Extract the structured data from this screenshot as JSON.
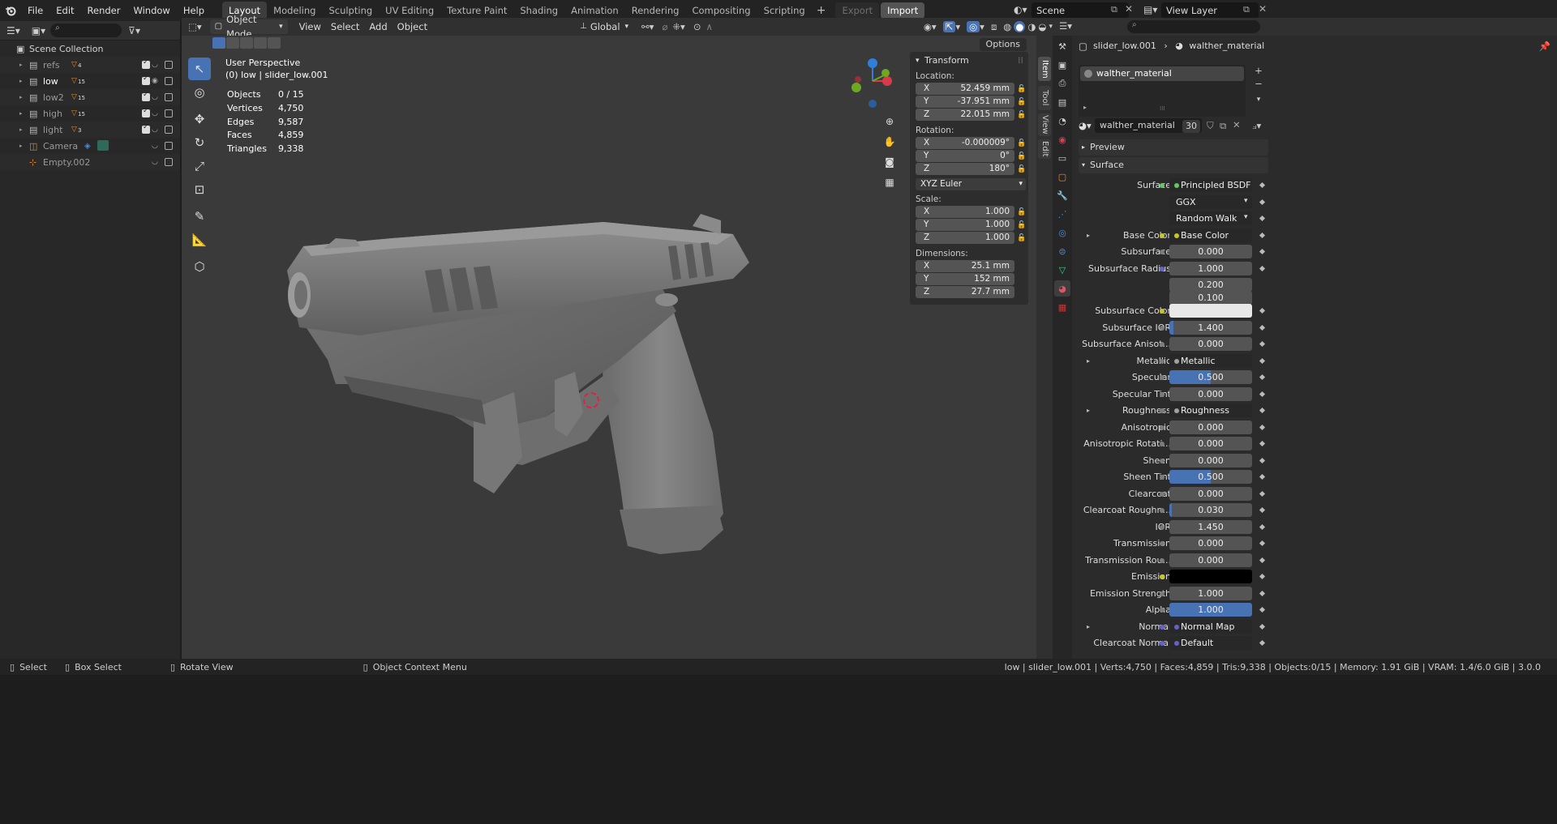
{
  "menu": [
    "File",
    "Edit",
    "Render",
    "Window",
    "Help"
  ],
  "workspaces": [
    "Layout",
    "Modeling",
    "Sculpting",
    "UV Editing",
    "Texture Paint",
    "Shading",
    "Animation",
    "Rendering",
    "Compositing",
    "Scripting"
  ],
  "export_label": "Export",
  "import_label": "Import",
  "scene_name": "Scene",
  "view_layer": "View Layer",
  "outliner": {
    "root": "Scene Collection",
    "items": [
      {
        "name": "refs",
        "count": "4"
      },
      {
        "name": "low",
        "count": "15"
      },
      {
        "name": "low2",
        "count": "15"
      },
      {
        "name": "high",
        "count": "15"
      },
      {
        "name": "light",
        "count": "3"
      },
      {
        "name": "Camera",
        "count": ""
      },
      {
        "name": "Empty.002",
        "count": ""
      }
    ]
  },
  "viewport": {
    "mode": "Object Mode",
    "menus": [
      "View",
      "Select",
      "Add",
      "Object"
    ],
    "orientation": "Global",
    "options": "Options",
    "perspective": "User Perspective",
    "object_line": "(0) low | slider_low.001",
    "stats": [
      {
        "k": "Objects",
        "v": "0 / 15"
      },
      {
        "k": "Vertices",
        "v": "4,750"
      },
      {
        "k": "Edges",
        "v": "9,587"
      },
      {
        "k": "Faces",
        "v": "4,859"
      },
      {
        "k": "Triangles",
        "v": "9,338"
      }
    ]
  },
  "transform": {
    "title": "Transform",
    "location_label": "Location:",
    "location": [
      "52.459 mm",
      "-37.951 mm",
      "22.015 mm"
    ],
    "rotation_label": "Rotation:",
    "rotation": [
      "-0.000009°",
      "0°",
      "180°"
    ],
    "rotation_mode": "XYZ Euler",
    "scale_label": "Scale:",
    "scale": [
      "1.000",
      "1.000",
      "1.000"
    ],
    "dimensions_label": "Dimensions:",
    "dimensions": [
      "25.1 mm",
      "152 mm",
      "27.7 mm"
    ],
    "axes": [
      "X",
      "Y",
      "Z"
    ]
  },
  "side_tabs": [
    "Item",
    "Tool",
    "View",
    "Edit"
  ],
  "properties": {
    "object": "slider_low.001",
    "material": "walther_material",
    "slot": "walther_material",
    "users": "30",
    "preview": "Preview",
    "surface_section": "Surface",
    "rows": [
      {
        "label": "Surface",
        "value": "Principled BSDF",
        "kind": "node",
        "dot": "#63c763"
      },
      {
        "label": "",
        "value": "GGX",
        "kind": "dd"
      },
      {
        "label": "",
        "value": "Random Walk",
        "kind": "dd"
      },
      {
        "label": "Base Color",
        "value": "Base Color",
        "kind": "node",
        "dot": "#c7c729",
        "expand": true
      },
      {
        "label": "Subsurface",
        "value": "0.000",
        "kind": "num"
      },
      {
        "label": "Subsurface Radius",
        "value": "1.000",
        "kind": "num",
        "dot": "#6363c7"
      },
      {
        "label": "",
        "value": "0.200",
        "kind": "num"
      },
      {
        "label": "",
        "value": "0.100",
        "kind": "num"
      },
      {
        "label": "Subsurface Color",
        "value": "",
        "kind": "white",
        "dot": "#c7c729"
      },
      {
        "label": "Subsurface IOR",
        "value": "1.400",
        "kind": "num",
        "fill": 0.05
      },
      {
        "label": "Subsurface Anisot...",
        "value": "0.000",
        "kind": "num"
      },
      {
        "label": "Metallic",
        "value": "Metallic",
        "kind": "node",
        "expand": true
      },
      {
        "label": "Specular",
        "value": "0.500",
        "kind": "num",
        "fill": 0.5
      },
      {
        "label": "Specular Tint",
        "value": "0.000",
        "kind": "num"
      },
      {
        "label": "Roughness",
        "value": "Roughness",
        "kind": "node",
        "expand": true
      },
      {
        "label": "Anisotropic",
        "value": "0.000",
        "kind": "num"
      },
      {
        "label": "Anisotropic Rotati...",
        "value": "0.000",
        "kind": "num"
      },
      {
        "label": "Sheen",
        "value": "0.000",
        "kind": "num"
      },
      {
        "label": "Sheen Tint",
        "value": "0.500",
        "kind": "num",
        "fill": 0.5
      },
      {
        "label": "Clearcoat",
        "value": "0.000",
        "kind": "num"
      },
      {
        "label": "Clearcoat Roughn...",
        "value": "0.030",
        "kind": "num",
        "fill": 0.03
      },
      {
        "label": "IOR",
        "value": "1.450",
        "kind": "num"
      },
      {
        "label": "Transmission",
        "value": "0.000",
        "kind": "num"
      },
      {
        "label": "Transmission Rou...",
        "value": "0.000",
        "kind": "num"
      },
      {
        "label": "Emission",
        "value": "",
        "kind": "black",
        "dot": "#c7c729"
      },
      {
        "label": "Emission Strength",
        "value": "1.000",
        "kind": "num"
      },
      {
        "label": "Alpha",
        "value": "1.000",
        "kind": "num",
        "fill": 1.0
      },
      {
        "label": "Normal",
        "value": "Normal Map",
        "kind": "node",
        "dot": "#6363c7",
        "expand": true
      },
      {
        "label": "Clearcoat Normal",
        "value": "Default",
        "kind": "node",
        "dot": "#6363c7"
      }
    ]
  },
  "status": {
    "select": "Select",
    "box_select": "Box Select",
    "rotate": "Rotate View",
    "context": "Object Context Menu",
    "info": "low | slider_low.001 | Verts:4,750 | Faces:4,859 | Tris:9,338 | Objects:0/15 | Memory: 1.91 GiB | VRAM: 1.4/6.0 GiB | 3.0.0"
  },
  "colors": {
    "accent": "#4772b3",
    "bg": "#3a3a3a"
  }
}
